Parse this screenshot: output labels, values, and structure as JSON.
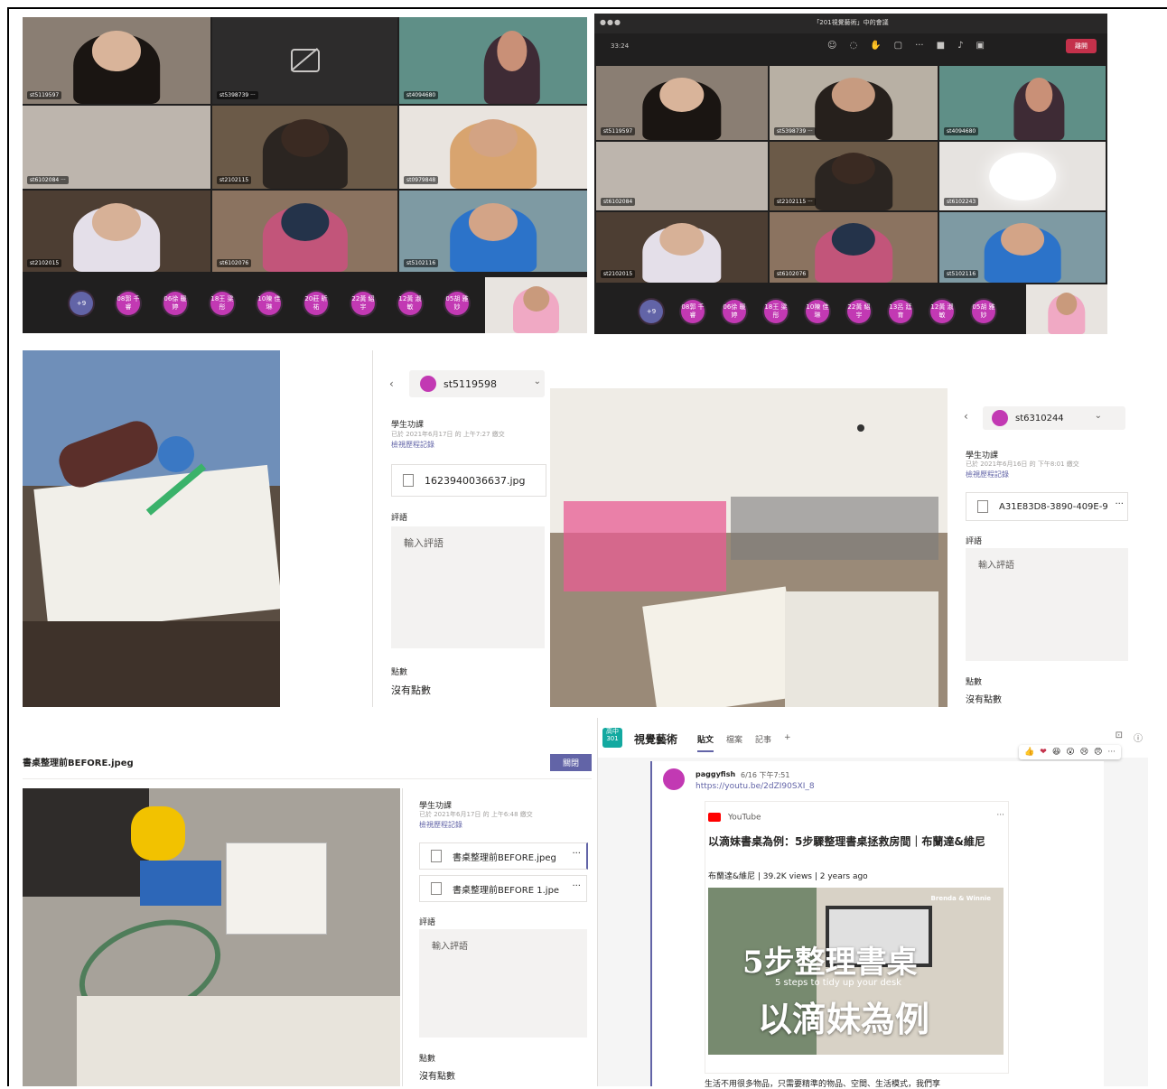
{
  "meeting_left": {
    "tiles": [
      {
        "name": "st5119597"
      },
      {
        "name": "st5398739 ···"
      },
      {
        "name": "st4094680"
      },
      {
        "name": "st6102084 ···"
      },
      {
        "name": "st2102115"
      },
      {
        "name": "st0979848"
      },
      {
        "name": "st2102015"
      },
      {
        "name": "st6102076"
      },
      {
        "name": "st5102116"
      }
    ],
    "roster": [
      "+9",
      "08郭 千睿",
      "06徐 暖婷",
      "18王 梁彤",
      "10陳 佳琳",
      "20莊 昕祐",
      "22黃 紹宇",
      "12黃 淑敏",
      "05胡 雅妙"
    ]
  },
  "meeting_right": {
    "title": "「201視覺藝術」中的會議",
    "timer": "33:24",
    "leave_label": "離開",
    "tiles": [
      {
        "name": "st5119597"
      },
      {
        "name": "st5398739 ···"
      },
      {
        "name": "st4094680"
      },
      {
        "name": "st6102084"
      },
      {
        "name": "st2102115 ···"
      },
      {
        "name": "st6102243"
      },
      {
        "name": "st2102015"
      },
      {
        "name": "st6102076"
      },
      {
        "name": "st5102116"
      }
    ],
    "roster": [
      "+9",
      "08郭 千睿",
      "06徐 暖婷",
      "18王 梁彤",
      "10陳 佳琳",
      "22黃 紹宇",
      "13呂 廷育",
      "12黃 淑敏",
      "05胡 雅妙"
    ]
  },
  "grade_a": {
    "student": "st5119598",
    "assignment_label": "學生功課",
    "submitted": "已於 2021年6月17日 的 上午7:27 繳交",
    "history_link": "檢視歷程記錄",
    "file": "1623940036637.jpg",
    "comment_label": "評語",
    "comment_placeholder": "輸入評語",
    "points_label": "點數",
    "points_value": "沒有點數"
  },
  "grade_b": {
    "student": "st6310244",
    "assignment_label": "學生功課",
    "submitted": "已於 2021年6月16日 的 下午8:01 繳交",
    "history_link": "檢視歷程記錄",
    "file": "A31E83D8-3890-409E-9",
    "comment_label": "評語",
    "comment_placeholder": "輸入評語",
    "points_label": "點數",
    "points_value": "沒有點數"
  },
  "grade_c": {
    "file_title": "書桌整理前BEFORE.jpeg",
    "close_label": "關閉",
    "assignment_label": "學生功課",
    "submitted": "已於 2021年6月17日 的 上午6:48 繳交",
    "history_link": "檢視歷程記錄",
    "files": [
      "書桌整理前BEFORE.jpeg",
      "書桌整理前BEFORE 1.jpe"
    ],
    "comment_label": "評語",
    "comment_placeholder": "輸入評語",
    "points_label": "點數",
    "points_value": "沒有點數"
  },
  "channel": {
    "team_badge": "高中 301",
    "name": "視覺藝術",
    "tabs": [
      "貼文",
      "檔案",
      "記事"
    ],
    "reactions": [
      "👍",
      "❤",
      "😆",
      "😮",
      "😢",
      "😠"
    ],
    "post": {
      "author": "paggyfish",
      "time": "6/16 下午7:51",
      "link": "https://youtu.be/2dZI90SXI_8",
      "source": "YouTube",
      "title": "以滴妹書桌為例：5步驟整理書桌拯救房間｜布蘭達&維尼",
      "meta": "布蘭達&維尼 | 39.2K views | 2 years ago",
      "thumb_brand": "Brenda & Winnie",
      "thumb_big1": "5步整理書桌",
      "thumb_sub": "5 steps to tidy up your desk",
      "thumb_big2": "以滴妹為例",
      "body": "生活不用很多物品，只需要精準的物品、空間、生活模式，我們享"
    }
  }
}
